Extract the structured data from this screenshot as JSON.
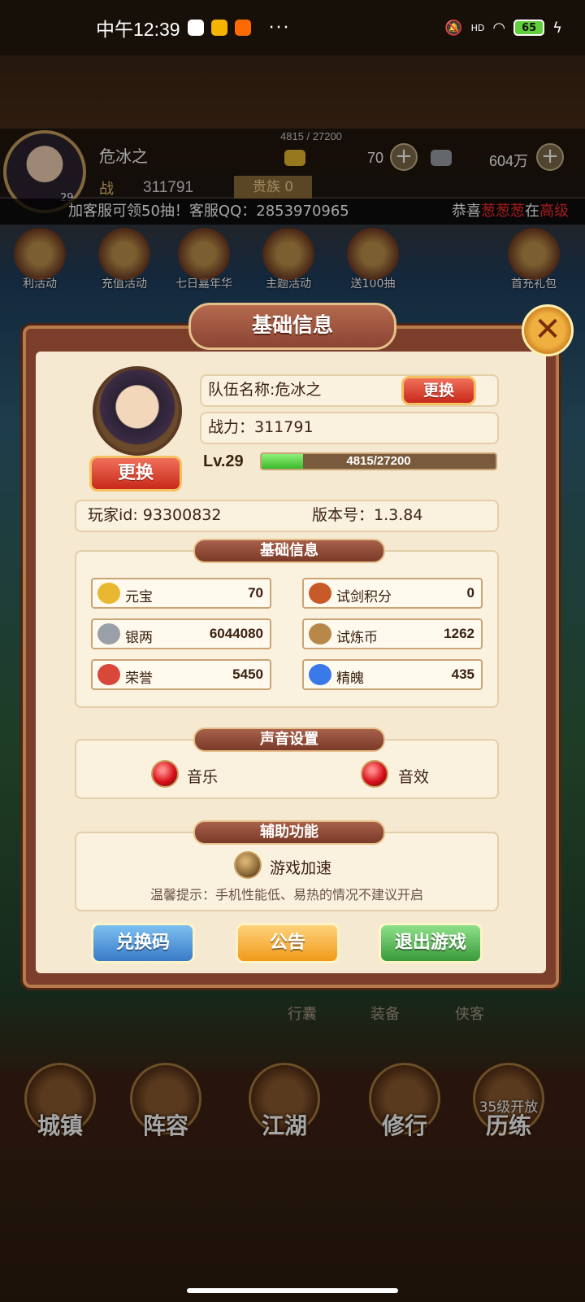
{
  "status_bar": {
    "time": "中午12:39",
    "dots": "···",
    "signal": "HD",
    "battery": "65"
  },
  "hud": {
    "player_name": "危冰之",
    "exp_text": "4815 / 27200",
    "power_label": "战",
    "power": "311791",
    "noble_label": "贵族 0",
    "gold": "70",
    "silver": "604万",
    "level": "29"
  },
  "marquee": {
    "text1": "加客服可领50抽！客服QQ：2853970965",
    "text2_prefix": "恭喜",
    "text2_name": "葱葱葱",
    "text2_mid": "在",
    "text2_tail": "高级"
  },
  "events": [
    "利活动",
    "充值活动",
    "七日嘉年华",
    "主题活动",
    "送100抽",
    "首充礼包"
  ],
  "bottom_nav": {
    "sub": [
      "行囊",
      "装备",
      "侠客"
    ],
    "main": [
      "城镇",
      "阵容",
      "江湖",
      "修行",
      "历练"
    ],
    "locked_text": "35级开放"
  },
  "dialog": {
    "title": "基础信息",
    "close": "✕",
    "portrait_button": "更换",
    "team_name": "队伍名称:危冰之",
    "team_button": "更换",
    "power": "战力：311791",
    "level": "Lv.29",
    "exp_text": "4815/27200",
    "exp_fraction": 0.177,
    "player_id": "玩家id: 93300832",
    "version": "版本号：1.3.84",
    "basic_section": "基础信息",
    "resources": [
      {
        "name": "元宝",
        "value": "70",
        "color": "#e8b830"
      },
      {
        "name": "试剑积分",
        "value": "0",
        "color": "#c85a2a"
      },
      {
        "name": "银两",
        "value": "6044080",
        "color": "#9aa0a8"
      },
      {
        "name": "试炼币",
        "value": "1262",
        "color": "#b8884a"
      },
      {
        "name": "荣誉",
        "value": "5450",
        "color": "#d8483a"
      },
      {
        "name": "精魄",
        "value": "435",
        "color": "#3a7ae8"
      }
    ],
    "sound_section": "声音设置",
    "music": "音乐",
    "sfx": "音效",
    "assist_section": "辅助功能",
    "speed": "游戏加速",
    "tip": "温馨提示：手机性能低、易热的情况不建议开启",
    "btn_code": "兑换码",
    "btn_notice": "公告",
    "btn_exit": "退出游戏"
  }
}
